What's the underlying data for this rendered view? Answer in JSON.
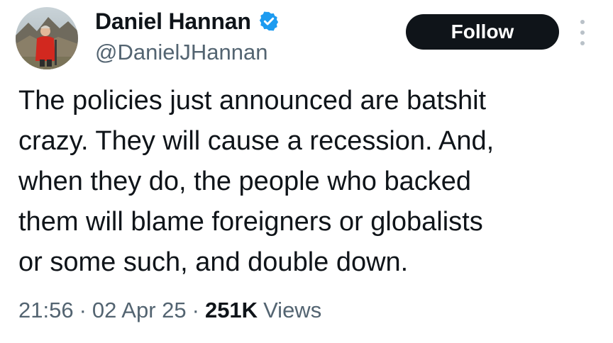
{
  "author": {
    "display_name": "Daniel Hannan",
    "handle": "@DanielJHannan",
    "verified_icon": "verified-badge-icon",
    "avatar_icon": "profile-photo"
  },
  "actions": {
    "follow_label": "Follow",
    "more_icon": "more-options-icon"
  },
  "tweet": {
    "text": "The policies just announced are batshit\ncrazy. They will cause a recession. And,\nwhen they do, the people who backed\nthem will blame foreigners or globalists\nor some such, and double down.",
    "time": "21:56",
    "separator": "·",
    "date": "02 Apr 25",
    "views_count": "251K",
    "views_label": "Views"
  },
  "colors": {
    "text_primary": "#0f1419",
    "text_secondary": "#536471",
    "verified_blue": "#1d9bf0",
    "button_bg": "#0f1419",
    "button_text": "#ffffff",
    "more_dots": "#b9c1c8"
  }
}
